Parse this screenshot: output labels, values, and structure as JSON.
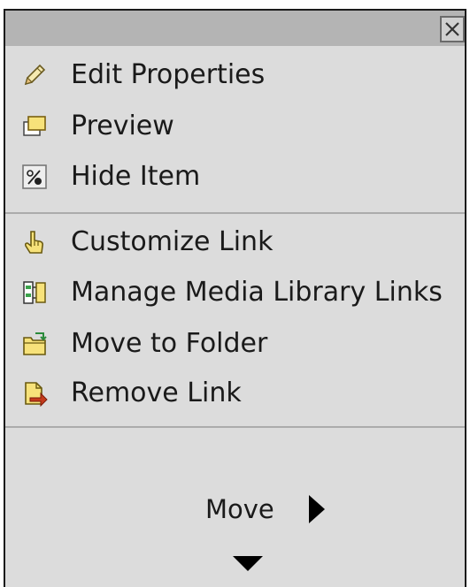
{
  "menu": {
    "groups": [
      [
        {
          "label": "Edit Properties",
          "icon": "pencil-icon"
        },
        {
          "label": "Preview",
          "icon": "preview-window-icon"
        },
        {
          "label": "Hide Item",
          "icon": "hide-item-icon"
        }
      ],
      [
        {
          "label": "Customize Link",
          "icon": "hand-pointer-icon"
        },
        {
          "label": "Manage Media Library Links",
          "icon": "media-library-links-icon"
        },
        {
          "label": "Move to Folder",
          "icon": "folder-move-icon"
        },
        {
          "label": "Remove Link",
          "icon": "remove-link-icon"
        }
      ]
    ]
  },
  "footer": {
    "move_label": "Move"
  },
  "colors": {
    "menu_background": "#dcdcdc",
    "titlebar": "#b4b4b4",
    "separator": "#ababab",
    "icon_yellow": "#f7e27a",
    "icon_red": "#c43a1c"
  }
}
